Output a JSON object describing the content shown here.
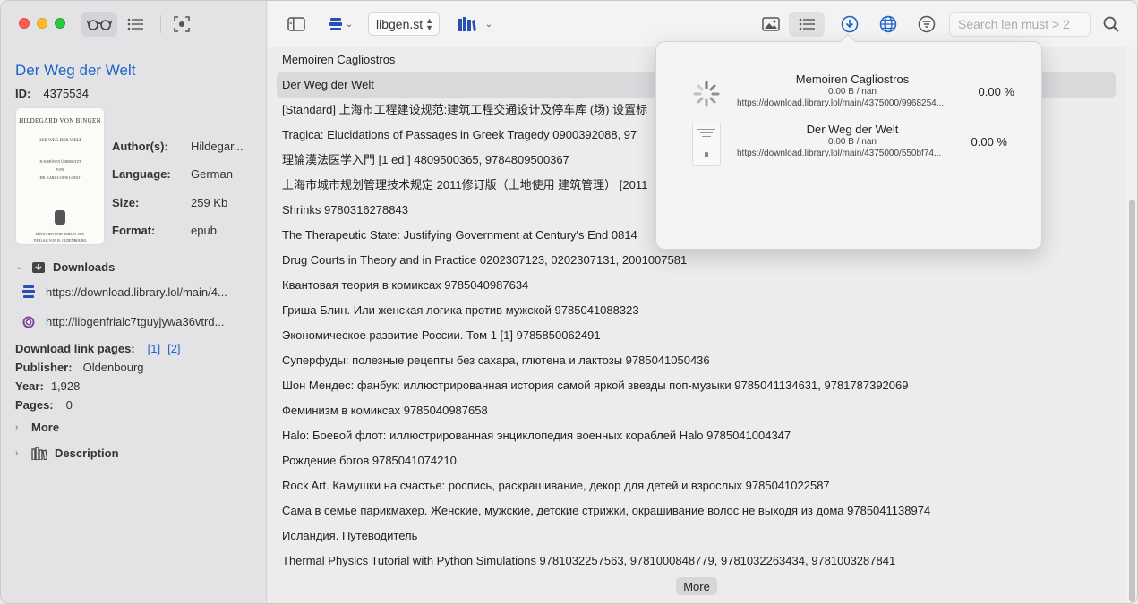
{
  "sidebar": {
    "title": "Der Weg der Welt",
    "id_label": "ID:",
    "id_value": "4375534",
    "cover": {
      "author": "HILDEGARD VON BINGEN",
      "title": "DER WEG DER WELT",
      "line1": "IN SCHÖNEN ÜBERSETZT",
      "line2": "VON",
      "line3": "DR. KARL-LOUIS LOEST",
      "publisher_city": "MÜNCHEN UND BERLIN 1929",
      "publisher": "VERLAG VON R. OLDENBOURG"
    },
    "meta": [
      {
        "label": "Author(s):",
        "value": "Hildegar..."
      },
      {
        "label": "Language:",
        "value": "German"
      },
      {
        "label": "Size:",
        "value": "259 Kb"
      },
      {
        "label": "Format:",
        "value": "epub"
      }
    ],
    "downloads_label": "Downloads",
    "download_links": [
      {
        "icon": "libgen-icon",
        "text": "https://download.library.lol/main/4..."
      },
      {
        "icon": "tor-icon",
        "text": "http://libgenfrialc7tguyjywa36vtrd..."
      }
    ],
    "download_link_pages_label": "Download link pages:",
    "download_link_pages": [
      "[1]",
      "[2]"
    ],
    "publisher_label": "Publisher:",
    "publisher_value": "Oldenbourg",
    "year_label": "Year:",
    "year_value": "1,928",
    "pages_label": "Pages:",
    "pages_value": "0",
    "more_label": "More",
    "description_label": "Description"
  },
  "toolbar": {
    "source": "libgen.st",
    "search_placeholder": "Search len must > 2"
  },
  "list": {
    "items": [
      "Memoiren Cagliostros",
      "Der Weg der Welt",
      "[Standard] 上海市工程建设规范:建筑工程交通设计及停车库 (场) 设置标",
      "Tragica: Elucidations of Passages in Greek Tragedy 0900392088, 97",
      "理論漢法医学入門 [1 ed.] 4809500365, 9784809500367",
      "上海市城市规划管理技术规定 2011修订版（土地使用 建筑管理） [2011",
      "Shrinks 9780316278843",
      "The Therapeutic State: Justifying Government at Century's End 0814",
      "Drug Courts in Theory and in Practice 0202307123, 0202307131, 2001007581",
      "Квантовая теория в комиксах 9785040987634",
      "Гриша Блин. Или женская логика против мужской 9785041088323",
      "Экономическое развитие России. Том 1 [1] 9785850062491",
      "Суперфуды: полезные рецепты без сахара, глютена и лактозы 9785041050436",
      "Шон Мендес: фанбук: иллюстрированная история самой яркой звезды поп-музыки 9785041134631, 9781787392069",
      "Феминизм в комиксах 9785040987658",
      "Halo: Боевой флот: иллюстрированная энциклопедия военных кораблей Halo 9785041004347",
      "Рождение богов 9785041074210",
      "Rock Art. Камушки на счастье: роспись, раскрашивание, декор для детей и взрослых 9785041022587",
      "Сама в семье парикмахер. Женские, мужские, детские стрижки, окрашивание волос не выходя из дома 9785041138974",
      "Исландия. Путеводитель",
      "Thermal Physics Tutorial with Python Simulations 9781032257563, 9781000848779, 9781032263434, 9781003287841"
    ],
    "selected_index": 1,
    "more_button": "More"
  },
  "downloads_popover": {
    "items": [
      {
        "title": "Memoiren Cagliostros",
        "size": "0.00 B / nan",
        "url": "https://download.library.lol/main/4375000/9968254...",
        "percent": "0.00 %",
        "state": "loading"
      },
      {
        "title": "Der Weg der Welt",
        "size": "0.00 B / nan",
        "url": "https://download.library.lol/main/4375000/550bf74...",
        "percent": "0.00 %",
        "state": "thumbnail"
      }
    ]
  },
  "colors": {
    "accent": "#1e63c7",
    "selected_row": "#d9d9dc",
    "sidebar_bg": "#e3e3e6"
  }
}
